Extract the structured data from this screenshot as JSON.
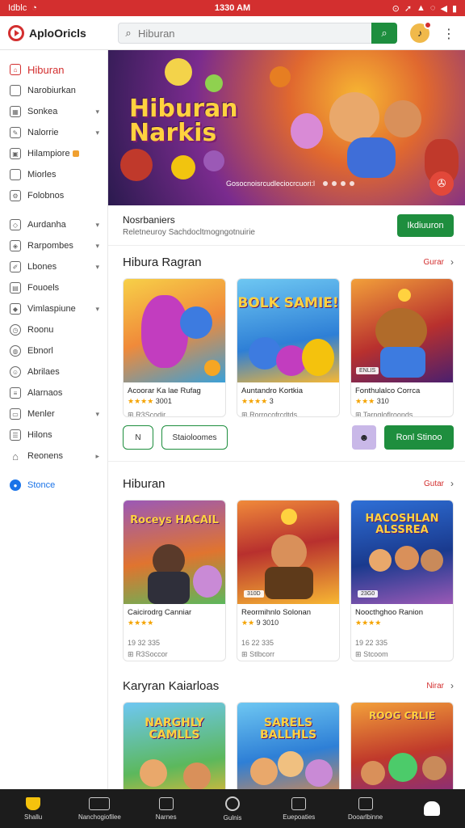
{
  "status_bar": {
    "left_text": "Idblc",
    "time": "1330 AM"
  },
  "app": {
    "name": "AploOricls"
  },
  "search": {
    "placeholder": "Hiburan"
  },
  "sidebar": {
    "items": [
      {
        "label": "Hiburan",
        "icon": "home-icon",
        "active": true
      },
      {
        "label": "Narobiurkan",
        "icon": "square-icon"
      },
      {
        "label": "Sonkea",
        "icon": "grid-icon",
        "chevron": true
      },
      {
        "label": "Nalorrie",
        "icon": "pencil-icon",
        "chevron": true
      },
      {
        "label": "Hilampiore",
        "icon": "image-icon",
        "badge": true
      },
      {
        "label": "Miorles",
        "icon": "folder-icon"
      },
      {
        "label": "Folobnos",
        "icon": "gear-icon"
      },
      {
        "label": "Aurdanha",
        "icon": "tag-icon",
        "chevron": true
      },
      {
        "label": "Rarpombes",
        "icon": "cube-icon",
        "chevron": true
      },
      {
        "label": "Lbones",
        "icon": "edit-icon",
        "chevron": true
      },
      {
        "label": "Fouoels",
        "icon": "book-icon"
      },
      {
        "label": "Vimlaspiune",
        "icon": "diamond-icon",
        "chevron": true
      },
      {
        "label": "Roonu",
        "icon": "clock-icon"
      },
      {
        "label": "Ebnorl",
        "icon": "globe-icon"
      },
      {
        "label": "Abrilaes",
        "icon": "people-icon"
      },
      {
        "label": "Alarnaos",
        "icon": "list-icon"
      },
      {
        "label": "Menler",
        "icon": "card-icon",
        "chevron": true
      },
      {
        "label": "Hilons",
        "icon": "menu-icon"
      },
      {
        "label": "Reonens",
        "icon": "house-icon",
        "chevron_small": true
      }
    ],
    "store_label": "Stonce"
  },
  "hero": {
    "title_line1": "Hiburan",
    "title_line2": "Narkis",
    "caption": "Gosocnoisrcudleciocrcuori:l",
    "fab_icon": "controller-icon"
  },
  "promo": {
    "title": "Nosrbaniers",
    "subtitle": "Reletneuroy Sachdocltmogngotnuirie",
    "button": "Ikdiuuron"
  },
  "section1": {
    "title": "Hibura Ragran",
    "more": "Gurar",
    "cards": [
      {
        "title": "Acoorar Ka lae Rufag",
        "stars": "★★★★",
        "rating": "3001",
        "meta": "R3Scodir",
        "art_text": ""
      },
      {
        "title": "Auntandro Kortkia",
        "stars": "★★★★",
        "rating": "3",
        "meta": "Rorrocofrcdtds",
        "art_text": "BOLK SAMIE!"
      },
      {
        "title": "Fonthulalco Corrca",
        "stars": "★★★",
        "rating": "310",
        "meta": "Tarngloflroonds",
        "art_text": ""
      }
    ],
    "actions": {
      "left_btn": "N",
      "mid_btn": "Staioloomes",
      "right_btn": "Ronl Stinoo"
    }
  },
  "section2": {
    "title": "Hiburan",
    "more": "Gutar",
    "cards": [
      {
        "title": "Caicirodrg Canniar",
        "stars": "★★★★",
        "rating": "",
        "meta1": "19 32 335",
        "meta2": "R3Soccor",
        "art_text": "Roceys HACAIL"
      },
      {
        "title": "Reormihnlo Solonan",
        "stars": "★★",
        "rating": "9 3010",
        "meta1": "16 22 335",
        "meta2": "Stlbcorr",
        "art_text": "",
        "tag": "310D"
      },
      {
        "title": "Noocthghoo Ranion",
        "stars": "★★★★",
        "rating": "",
        "meta1": "19 22 335",
        "meta2": "Stcoom",
        "art_text": "HACOSHLAN ALSSREA",
        "tag": "23G0"
      }
    ]
  },
  "section3": {
    "title": "Karyran Kaiarloas",
    "more": "Nirar",
    "cards": [
      {
        "art_text": "NARGHLY CAMLLS"
      },
      {
        "art_text": "SARELS BALLHLS"
      },
      {
        "art_text": "ROOG CRLIE"
      }
    ]
  },
  "bottom_nav": [
    {
      "label": "Shallu",
      "icon": "home-icon",
      "active": true
    },
    {
      "label": "Nanchogiofilee",
      "icon": "controller-icon"
    },
    {
      "label": "Narnes",
      "icon": "grid-icon"
    },
    {
      "label": "Gulnis",
      "icon": "circle-icon"
    },
    {
      "label": "Euepoaties",
      "icon": "video-icon"
    },
    {
      "label": "Dooarlbinne",
      "icon": "calendar-icon"
    },
    {
      "label": "",
      "icon": "person-icon"
    }
  ],
  "colors": {
    "accent_red": "#d32f2f",
    "accent_green": "#1e8e3e",
    "store_blue": "#1a73e8",
    "star": "#f4a300"
  }
}
